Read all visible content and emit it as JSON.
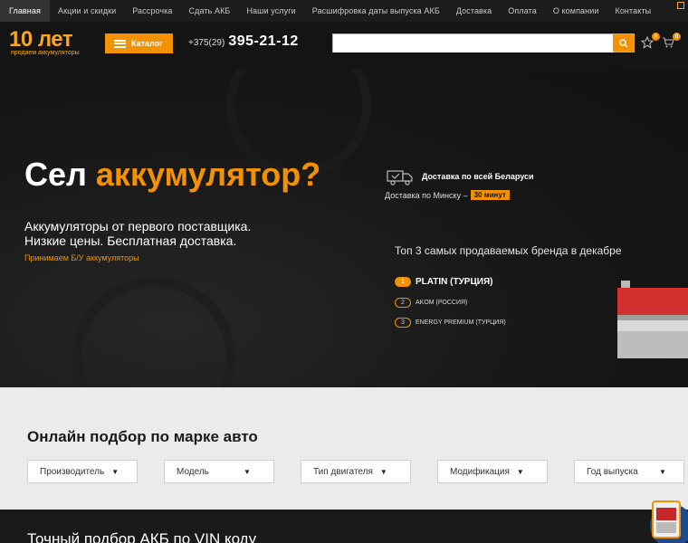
{
  "nav": {
    "items": [
      {
        "label": "Главная",
        "active": true
      },
      {
        "label": "Акции и скидки"
      },
      {
        "label": "Рассрочка"
      },
      {
        "label": "Сдать АКБ"
      },
      {
        "label": "Наши услуги"
      },
      {
        "label": "Расшифровка даты выпуска АКБ"
      },
      {
        "label": "Доставка"
      },
      {
        "label": "Оплата"
      },
      {
        "label": "О компании"
      },
      {
        "label": "Контакты"
      }
    ]
  },
  "header": {
    "logo_title": "10 лет",
    "logo_subtitle": "продаем аккумуляторы",
    "catalog_label": "Каталог",
    "phone_code": "+375(29)",
    "phone_number": "395-21-12",
    "search_placeholder": "",
    "favorites_count": "0",
    "cart_count": "0"
  },
  "hero": {
    "title_plain": "Сел ",
    "title_accent": "аккумулятор?",
    "subtitle_line1": "Аккумуляторы от первого поставщика.",
    "subtitle_line2": "Низкие цены. Бесплатная доставка.",
    "link": "Принимаем Б/У аккумуляторы",
    "delivery_belarus": "Доставка по всей Беларуси",
    "delivery_minsk": "Доставка по Минску –",
    "delivery_minsk_time": "30 минут",
    "top3_title": "Топ 3 самых продаваемых бренда в декабре",
    "brands": [
      {
        "num": "1",
        "name": "PLATIN (ТУРЦИЯ)"
      },
      {
        "num": "2",
        "name": "AKOM (РОССИЯ)"
      },
      {
        "num": "3",
        "name": "ENERGY PREMIUM (ТУРЦИЯ)"
      }
    ]
  },
  "selection": {
    "title": "Онлайн подбор по марке авто",
    "dropdowns": [
      {
        "label": "Производитель"
      },
      {
        "label": "Модель"
      },
      {
        "label": "Тип двигателя"
      },
      {
        "label": "Модификация"
      },
      {
        "label": "Год выпуска"
      }
    ]
  },
  "vin": {
    "title": "Точный подбор АКБ по VIN коду"
  },
  "colors": {
    "accent": "#f39200",
    "dark": "#141414",
    "light": "#ebebeb"
  }
}
